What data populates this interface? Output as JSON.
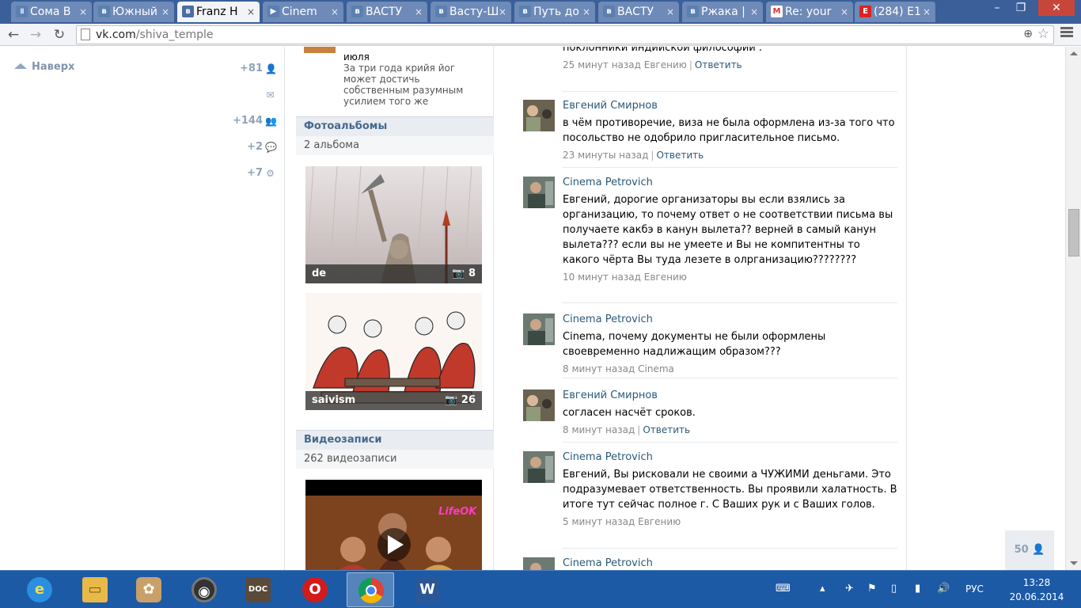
{
  "browser": {
    "tabs": [
      {
        "title": "Сома В",
        "icon": "pause-icon"
      },
      {
        "title": "Южный",
        "icon": "vk-icon"
      },
      {
        "title": "Franz H",
        "icon": "vk-icon",
        "active": true
      },
      {
        "title": "Cinem",
        "icon": "play-icon"
      },
      {
        "title": "ВАСТУ",
        "icon": "vk-icon"
      },
      {
        "title": "Васту-Ш",
        "icon": "vk-icon"
      },
      {
        "title": "Путь до",
        "icon": "vk-icon"
      },
      {
        "title": "ВАСТУ",
        "icon": "vk-icon"
      },
      {
        "title": "Ржака |",
        "icon": "vk-icon"
      },
      {
        "title": "Re: your",
        "icon": "gmail-icon"
      },
      {
        "title": "(284) E1",
        "icon": "e1-icon"
      }
    ],
    "url_host": "vk.com",
    "url_path": "/shiva_temple"
  },
  "left": {
    "to_top": "Наверх",
    "counters": [
      "+81",
      "+144",
      "+2",
      "+7"
    ]
  },
  "middle": {
    "post_month": "июля",
    "post_snippet": "За три года крийя йог может достичь собственным разумным усилием того же",
    "photos_title": "Фотоальбомы",
    "photos_count": "2 альбома",
    "albums": [
      {
        "name": "de",
        "count": "8"
      },
      {
        "name": "saivism",
        "count": "26"
      }
    ],
    "videos_title": "Видеозаписи",
    "videos_count": "262 видеозаписи",
    "video_logo": "LifeOK"
  },
  "comments": [
    {
      "author": "",
      "text": "поклонники индийской философии .",
      "time": "25 минут назад",
      "to": "Евгению",
      "reply": "Ответить"
    },
    {
      "author": "Евгений Смирнов",
      "text": "в чём противоречие, виза не была оформлена из-за того что посольство не одобрило пригласительное письмо.",
      "time": "23 минуты назад",
      "to": "",
      "reply": "Ответить"
    },
    {
      "author": "Cinema Petrovich",
      "text": "Евгений, дорогие организаторы вы если взялись за организацию, то почему ответ о не соответствии письма вы получаете какбэ в канун вылета?? верней в самый канун вылета??? если вы не умеете и Вы не компитентны то какого чёрта Вы туда лезете в олрганизацию????????",
      "time": "10 минут назад",
      "to": "Евгению",
      "reply": ""
    },
    {
      "author": "Cinema Petrovich",
      "text": "Cinema, почему документы не были оформлены своевременно надлижащим образом???",
      "time": "8 минут назад",
      "to": "Cinema",
      "reply": ""
    },
    {
      "author": "Евгений Смирнов",
      "text": "согласен насчёт сроков.",
      "time": "8 минут назад",
      "to": "",
      "reply": "Ответить"
    },
    {
      "author": "Cinema Petrovich",
      "text": "Евгений, Вы рисковали не своими а ЧУЖИМИ деньгами. Это подразумевает ответственность. Вы проявили халатность. В итоге тут сейчас полное г. С Ваших рук и с Ваших голов.",
      "time": "5 минут назад",
      "to": "Евгению",
      "reply": ""
    },
    {
      "author": "Cinema Petrovich",
      "text": "",
      "time": "",
      "to": "",
      "reply": ""
    }
  ],
  "online_count": "50",
  "taskbar": {
    "lang": "РУС",
    "time": "13:28",
    "date": "20.06.2014"
  },
  "colors": {
    "vk_link": "#2b587a",
    "vk_header": "#45688e",
    "taskbar": "#1c5aa6",
    "tabstrip": "#3a5f99"
  }
}
